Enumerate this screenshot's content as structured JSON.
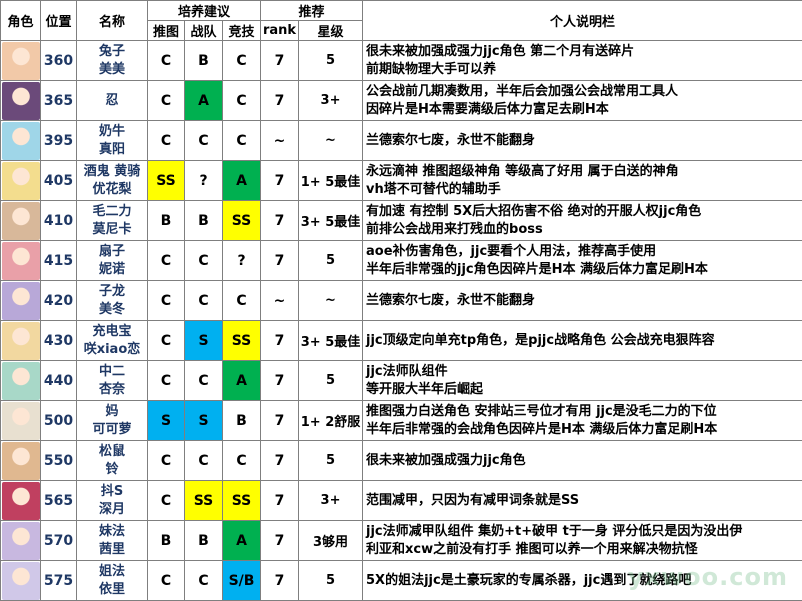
{
  "header": {
    "col_role": "角色",
    "col_pos": "位置",
    "col_name": "名称",
    "col_train": "培养建议",
    "col_rec": "推荐",
    "col_note": "个人说明栏",
    "sub_tuitu": "推图",
    "sub_zhandui": "战队",
    "sub_jingji": "竞技",
    "sub_rank": "rank",
    "sub_star": "星级"
  },
  "colors": {
    "yellow": "#ffff00",
    "green": "#00b050",
    "blue": "#00b0f0",
    "name_blue": "#1f3864"
  },
  "rows": [
    {
      "avatar": "avatar-rabbit-girl",
      "avatar_bg": "#f2c9a8",
      "pos": "360",
      "name1": "兔子",
      "name2": "美美",
      "tuitu": "C",
      "tuitu_bg": "",
      "zhandui": "B",
      "zhandui_bg": "",
      "jingji": "C",
      "jingji_bg": "",
      "rank": "7",
      "star": "5",
      "note1": "很未来被加强成强力jjc角色 第二个月有送碎片",
      "note2": "前期缺物理大手可以养"
    },
    {
      "avatar": "avatar-ninja-girl",
      "avatar_bg": "#6b4a7a",
      "pos": "365",
      "name1": "忍",
      "name2": "",
      "tuitu": "C",
      "tuitu_bg": "",
      "zhandui": "A",
      "zhandui_bg": "green",
      "jingji": "C",
      "jingji_bg": "",
      "rank": "7",
      "star": "3+",
      "note1": "公会战前几期凑数用，半年后会加强公会战常用工具人",
      "note2": "因碎片是H本需要满级后体力富足去刷H本"
    },
    {
      "avatar": "avatar-cow-girl",
      "avatar_bg": "#9fd6e8",
      "pos": "395",
      "name1": "奶牛",
      "name2": "真阳",
      "tuitu": "C",
      "tuitu_bg": "",
      "zhandui": "C",
      "zhandui_bg": "",
      "jingji": "C",
      "jingji_bg": "",
      "rank": "~",
      "star": "~",
      "note1": "兰德索尔七废，永世不能翻身",
      "note2": ""
    },
    {
      "avatar": "avatar-blonde-girl",
      "avatar_bg": "#f3dd8e",
      "pos": "405",
      "name1": "酒鬼 黄骑",
      "name2": "优花梨",
      "tuitu": "SS",
      "tuitu_bg": "yellow",
      "zhandui": "?",
      "zhandui_bg": "",
      "jingji": "A",
      "jingji_bg": "green",
      "rank": "7",
      "star": "1+ 5最佳",
      "note1": "永远滴神 推图超级神角 等级高了好用 属于白送的神角",
      "note2": "vh塔不可替代的辅助手"
    },
    {
      "avatar": "avatar-maid-girl",
      "avatar_bg": "#d8b89a",
      "pos": "410",
      "name1": "毛二力",
      "name2": "莫尼卡",
      "tuitu": "B",
      "tuitu_bg": "",
      "zhandui": "B",
      "zhandui_bg": "",
      "jingji": "SS",
      "jingji_bg": "yellow",
      "rank": "7",
      "star": "3+ 5最佳",
      "note1": "有加速 有控制 5X后大招伤害不俗 绝对的开服人权jjc角色",
      "note2": "前排公会战用来打残血的boss"
    },
    {
      "avatar": "avatar-fan-girl",
      "avatar_bg": "#e9a0a8",
      "pos": "415",
      "name1": "扇子",
      "name2": "妮诺",
      "tuitu": "C",
      "tuitu_bg": "",
      "zhandui": "C",
      "zhandui_bg": "",
      "jingji": "?",
      "jingji_bg": "",
      "rank": "7",
      "star": "5",
      "note1": "aoe补伤害角色，jjc要看个人用法，推荐高手使用",
      "note2": "半年后非常强的jjc角色因碎片是H本 满级后体力富足刷H本"
    },
    {
      "avatar": "avatar-dragon-girl",
      "avatar_bg": "#b8a8d8",
      "pos": "420",
      "name1": "子龙",
      "name2": "美冬",
      "tuitu": "C",
      "tuitu_bg": "",
      "zhandui": "C",
      "zhandui_bg": "",
      "jingji": "C",
      "jingji_bg": "",
      "rank": "~",
      "star": "~",
      "note1": "兰德索尔七废，永世不能翻身",
      "note2": ""
    },
    {
      "avatar": "avatar-battery-girl",
      "avatar_bg": "#f2d8a0",
      "pos": "430",
      "name1": "充电宝",
      "name2": "咲xiao恋",
      "tuitu": "C",
      "tuitu_bg": "",
      "zhandui": "S",
      "zhandui_bg": "blue",
      "jingji": "SS",
      "jingji_bg": "yellow",
      "rank": "7",
      "star": "3+ 5最佳",
      "note1": "jjc顶级定向单充tp角色，是pjjc战略角色 公会战充电狠阵容",
      "note2": ""
    },
    {
      "avatar": "avatar-mage-girl",
      "avatar_bg": "#a8d8c8",
      "pos": "440",
      "name1": "中二",
      "name2": "杏奈",
      "tuitu": "C",
      "tuitu_bg": "",
      "zhandui": "C",
      "zhandui_bg": "",
      "jingji": "A",
      "jingji_bg": "green",
      "rank": "7",
      "star": "5",
      "note1": "jjc法师队组件",
      "note2": "等开服大半年后崛起"
    },
    {
      "avatar": "avatar-mom-girl",
      "avatar_bg": "#e8e0d0",
      "pos": "500",
      "name1": "妈",
      "name2": "可可萝",
      "tuitu": "S",
      "tuitu_bg": "blue",
      "zhandui": "S",
      "zhandui_bg": "blue",
      "jingji": "B",
      "jingji_bg": "",
      "rank": "7",
      "star": "1+ 2舒服",
      "note1": "推图强力白送角色 安排站三号位才有用 jjc是没毛二力的下位",
      "note2": "半年后非常强的会战角色因碎片是H本 满级后体力富足刷H本"
    },
    {
      "avatar": "avatar-mouse-girl",
      "avatar_bg": "#e0b890",
      "pos": "550",
      "name1": "松鼠",
      "name2": "铃",
      "tuitu": "C",
      "tuitu_bg": "",
      "zhandui": "C",
      "zhandui_bg": "",
      "jingji": "C",
      "jingji_bg": "",
      "rank": "7",
      "star": "5",
      "note1": "很未来被加强成强力jjc角色",
      "note2": ""
    },
    {
      "avatar": "avatar-pirate-girl",
      "avatar_bg": "#c04060",
      "pos": "565",
      "name1": "抖S",
      "name2": "深月",
      "tuitu": "C",
      "tuitu_bg": "",
      "zhandui": "SS",
      "zhandui_bg": "yellow",
      "jingji": "SS",
      "jingji_bg": "yellow",
      "rank": "7",
      "star": "3+",
      "note1": "范围减甲，只因为有减甲词条就是SS",
      "note2": ""
    },
    {
      "avatar": "avatar-sister-girl",
      "avatar_bg": "#c8b8e0",
      "pos": "570",
      "name1": "妹法",
      "name2": "茜里",
      "tuitu": "B",
      "tuitu_bg": "",
      "zhandui": "B",
      "zhandui_bg": "",
      "jingji": "A",
      "jingji_bg": "green",
      "rank": "7",
      "star": "3够用",
      "note1": "jjc法师减甲队组件 集奶+t+破甲 t于一身 评分低只是因为没出伊",
      "note2": "利亚和xcw之前没有打手  推图可以养一个用来解决物抗怪"
    },
    {
      "avatar": "avatar-elder-sister-girl",
      "avatar_bg": "#d0c8e8",
      "pos": "575",
      "name1": "姐法",
      "name2": "依里",
      "tuitu": "C",
      "tuitu_bg": "",
      "zhandui": "C",
      "zhandui_bg": "",
      "jingji": "S/B",
      "jingji_bg": "blue",
      "rank": "7",
      "star": "5",
      "note1": "5X的姐法jjc是土豪玩家的专属杀器，jjc遇到了就绕路吧",
      "note2": ""
    }
  ],
  "watermark": "yxwoo.com"
}
